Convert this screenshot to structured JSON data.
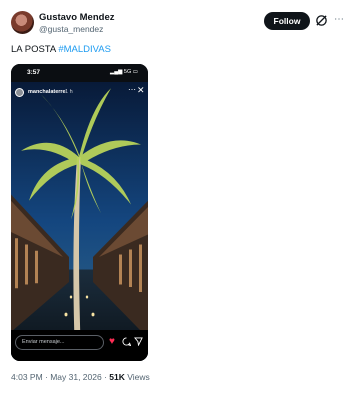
{
  "author": {
    "name": "Gustavo Mendez",
    "handle": "@gusta_mendez"
  },
  "actions": {
    "follow_label": "Follow",
    "more_label": "⋯"
  },
  "tweet": {
    "text_prefix": "LA POSTA ",
    "hashtag": "#MALDIVAS"
  },
  "media": {
    "status_time": "3:57",
    "status_icons": "▂▄▆ 5G ▭",
    "story_user": "manchalaterre",
    "story_time": "1 h",
    "story_more": "⋯",
    "story_close": "✕",
    "reply_placeholder": "Enviar mensaje...",
    "heart_icon": "♥",
    "colors": {
      "heart": "#ff2d55",
      "sky_top": "#0e2f5e",
      "palm": "#b8d35a",
      "lights": "#f7e3a3"
    }
  },
  "meta": {
    "time": "4:03 PM · May 31, 2026 · ",
    "views_count": "51K",
    "views_label": " Views"
  }
}
